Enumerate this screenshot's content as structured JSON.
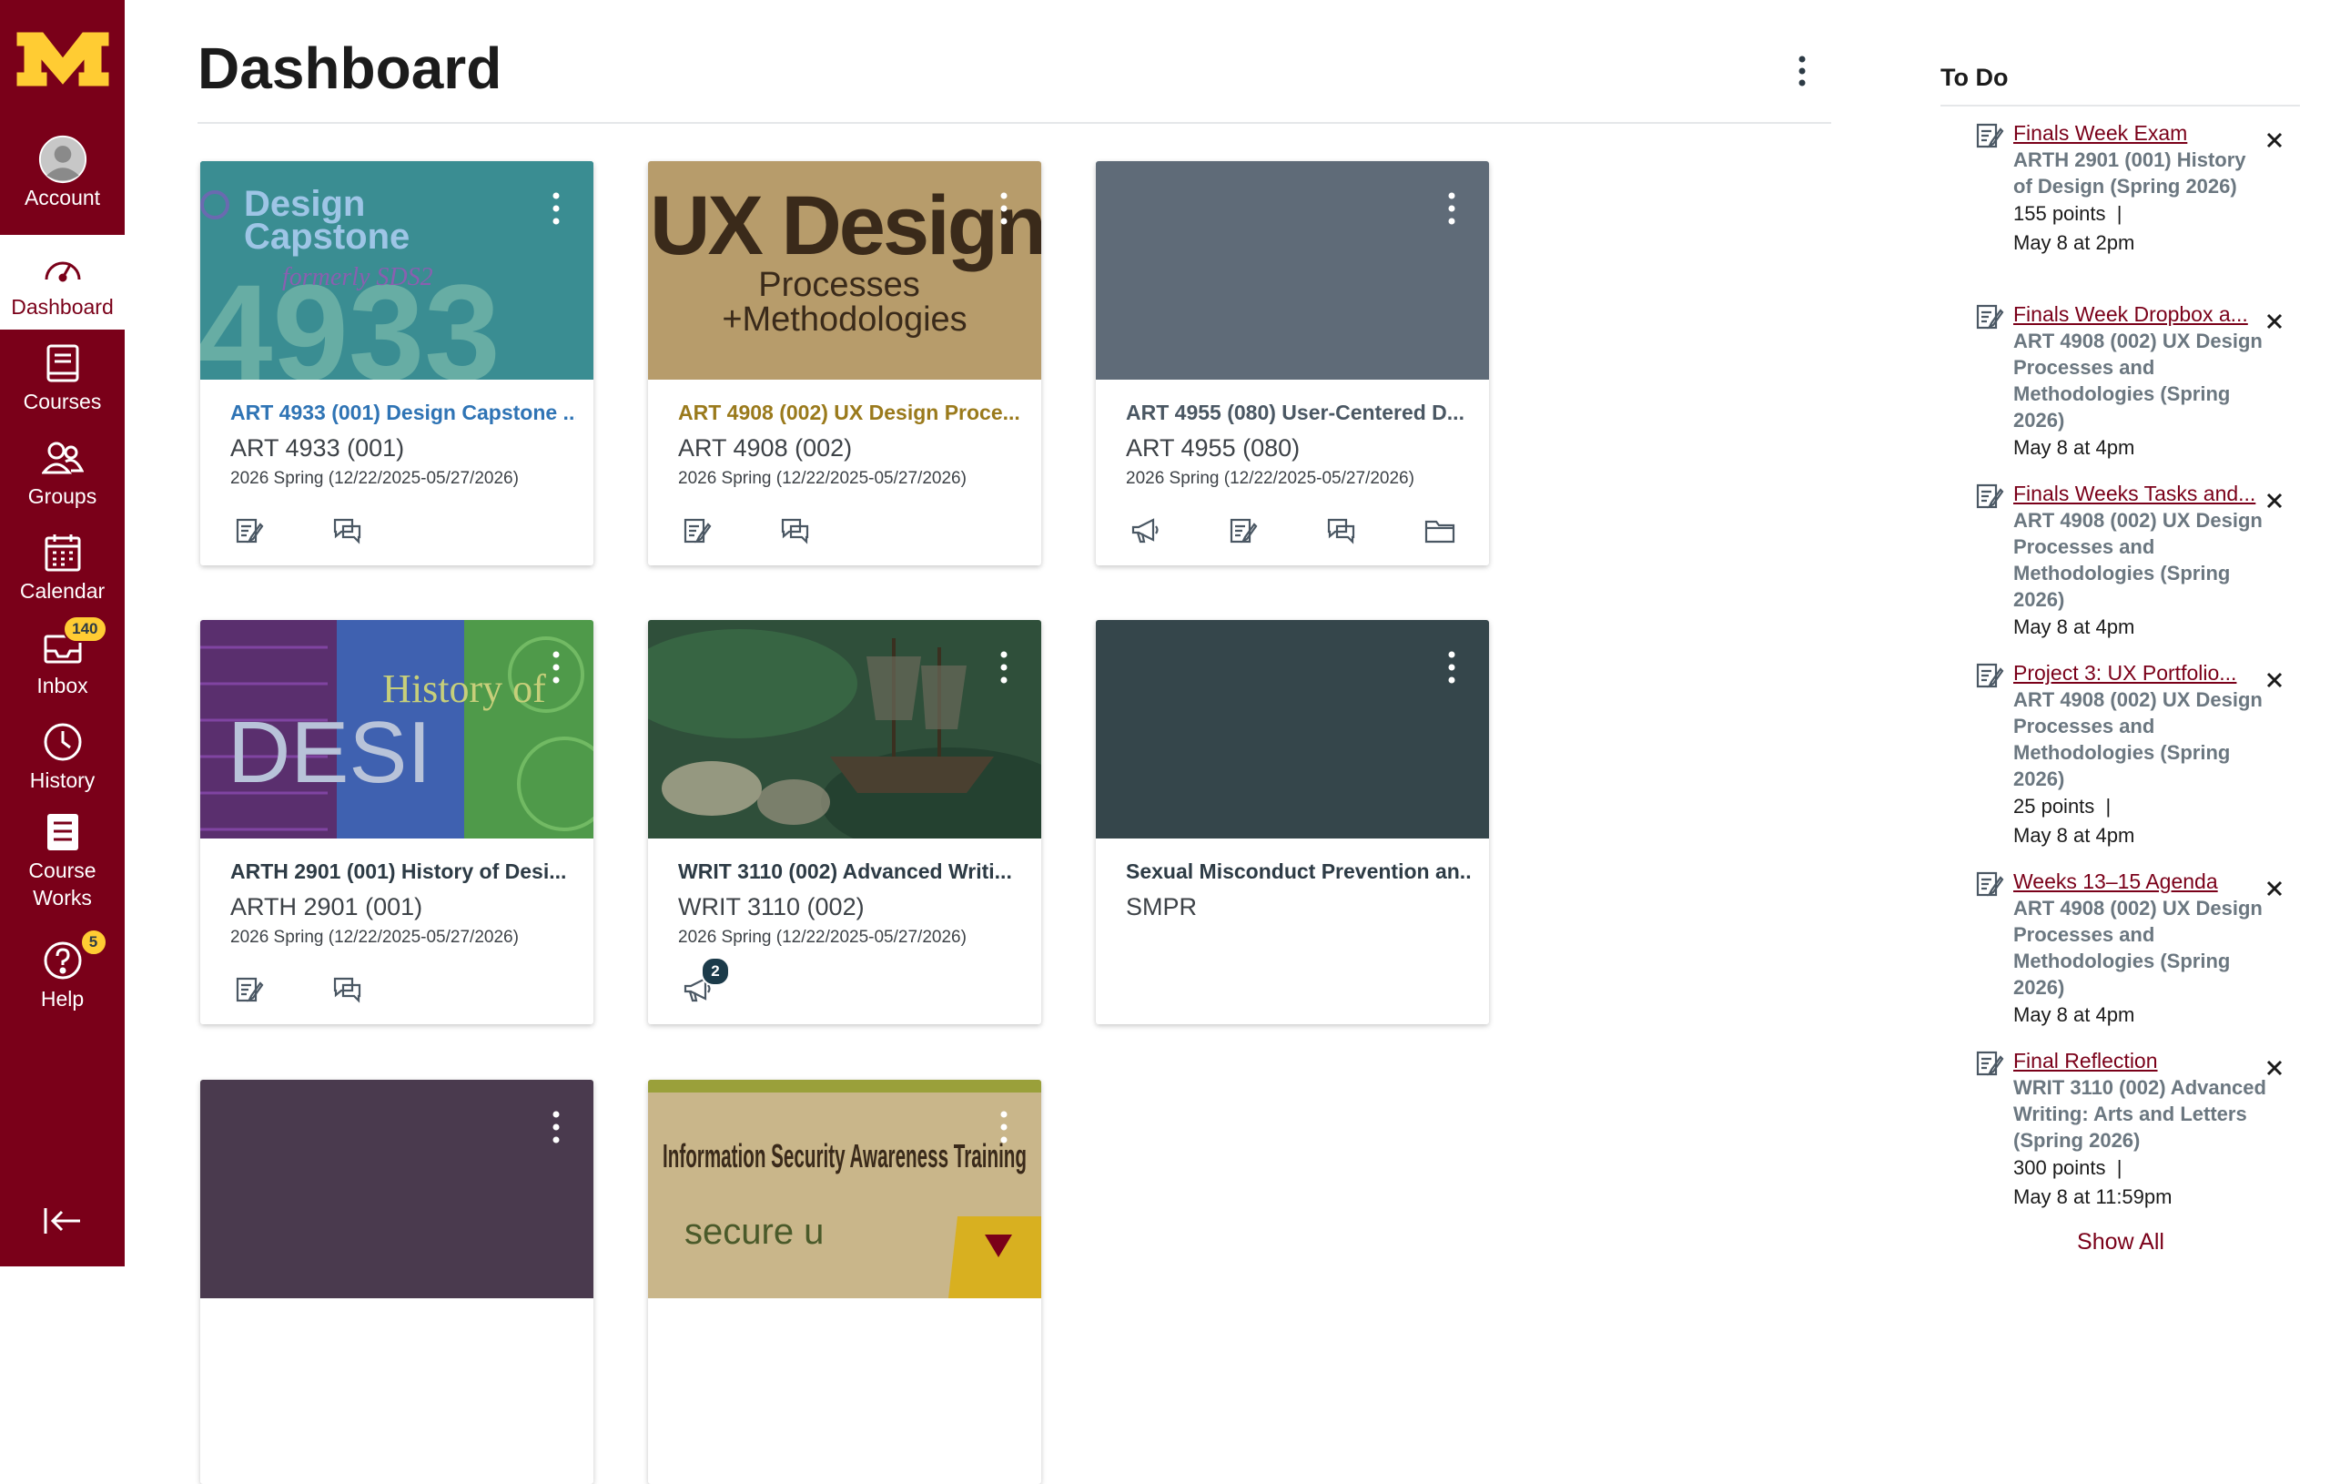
{
  "nav": {
    "items": [
      {
        "label": "Account"
      },
      {
        "label": "Dashboard"
      },
      {
        "label": "Courses"
      },
      {
        "label": "Groups"
      },
      {
        "label": "Calendar"
      },
      {
        "label": "Inbox",
        "badge": "140"
      },
      {
        "label": "History"
      },
      {
        "label": "Course Works"
      },
      {
        "label": "Help",
        "badge": "5"
      }
    ]
  },
  "header": {
    "title": "Dashboard"
  },
  "colors": {
    "brand": "#7a0019",
    "gold": "#ffcc33"
  },
  "cards": [
    {
      "name": "ART 4933 (001) Design Capstone ...",
      "code": "ART 4933 (001)",
      "term": "2026 Spring (12/22/2025-05/27/2026)",
      "color": "#2f74b5",
      "hero": {
        "line1": "Design",
        "line2": "Capstone",
        "line3": "formerly SDS2",
        "big": "4933"
      }
    },
    {
      "name": "ART 4908 (002) UX Design Proce...",
      "code": "ART 4908 (002)",
      "term": "2026 Spring (12/22/2025-05/27/2026)",
      "color": "#9a7a1c",
      "hero": {
        "line1": "UX Design",
        "line2": "Processes",
        "line3": "+Methodologies"
      }
    },
    {
      "name": "ART 4955 (080) User-Centered D...",
      "code": "ART 4955 (080)",
      "term": "2026 Spring (12/22/2025-05/27/2026)",
      "color": "#4a5763"
    },
    {
      "name": "ARTH 2901 (001) History of Desi...",
      "code": "ARTH 2901 (001)",
      "term": "2026 Spring (12/22/2025-05/27/2026)",
      "color": "#2d3b45",
      "hero": {
        "line1": "History of",
        "line2": "DESI"
      }
    },
    {
      "name": "WRIT 3110 (002) Advanced Writi...",
      "code": "WRIT 3110 (002)",
      "term": "2026 Spring (12/22/2025-05/27/2026)",
      "color": "#2d3b45",
      "announcement_badge": "2"
    },
    {
      "name": "Sexual Misconduct Prevention an...",
      "code": "SMPR",
      "color": "#2d3b45"
    },
    {
      "color": "#4a3a4a"
    },
    {
      "hero": {
        "line1": "Information Security Awareness Training",
        "line2": "secure u"
      }
    }
  ],
  "todo": {
    "title": "To Do",
    "items": [
      {
        "title": "Finals Week Exam",
        "course": "ARTH 2901 (001) History of Design (Spring 2026)",
        "points": "155 points",
        "sep": "|",
        "due": "May 8 at 2pm"
      },
      {
        "title": "Finals Week Dropbox a...",
        "course": "ART 4908 (002) UX Design Processes and Methodologies (Spring 2026)",
        "due": "May 8 at 4pm"
      },
      {
        "title": "Finals Weeks Tasks and...",
        "course": "ART 4908 (002) UX Design Processes and Methodologies (Spring 2026)",
        "due": "May 8 at 4pm"
      },
      {
        "title": "Project 3: UX Portfolio...",
        "course": "ART 4908 (002) UX Design Processes and Methodologies (Spring 2026)",
        "points": "25 points",
        "sep": "|",
        "due": "May 8 at 4pm"
      },
      {
        "title": "Weeks 13–15 Agenda",
        "course": "ART 4908 (002) UX Design Processes and Methodologies (Spring 2026)",
        "due": "May 8 at 4pm"
      },
      {
        "title": "Final Reflection",
        "course": "WRIT 3110 (002) Advanced Writing: Arts and Letters (Spring 2026)",
        "points": "300 points",
        "sep": "|",
        "due": "May 8 at 11:59pm"
      }
    ],
    "show_all": "Show All"
  }
}
